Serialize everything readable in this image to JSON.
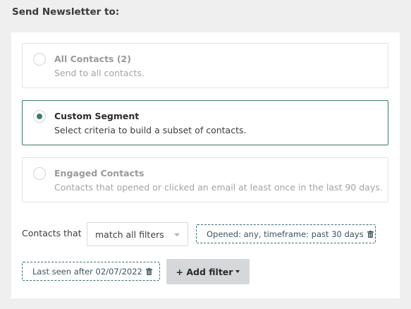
{
  "heading": "Send Newsletter to:",
  "options": [
    {
      "title": "All Contacts (2)",
      "description": "Send to all contacts.",
      "selected": false
    },
    {
      "title": "Custom Segment",
      "description": "Select criteria to build a subset of contacts.",
      "selected": true
    },
    {
      "title": "Engaged Contacts",
      "description": "Contacts that opened or clicked an email at least once in the last 90 days.",
      "selected": false
    }
  ],
  "filters": {
    "label": "Contacts that",
    "match_select": {
      "value": "match all filters"
    },
    "chips": [
      {
        "text": "Opened: any, timeframe: past 30 days",
        "icon": "trash-icon"
      },
      {
        "text": "Last seen after 02/07/2022",
        "icon": "trash-icon"
      }
    ],
    "add_filter_label": "+ Add filter"
  },
  "colors": {
    "accent": "#3c7d63",
    "chip_border": "#3a6b78",
    "add_button_bg": "#d4d8da"
  }
}
